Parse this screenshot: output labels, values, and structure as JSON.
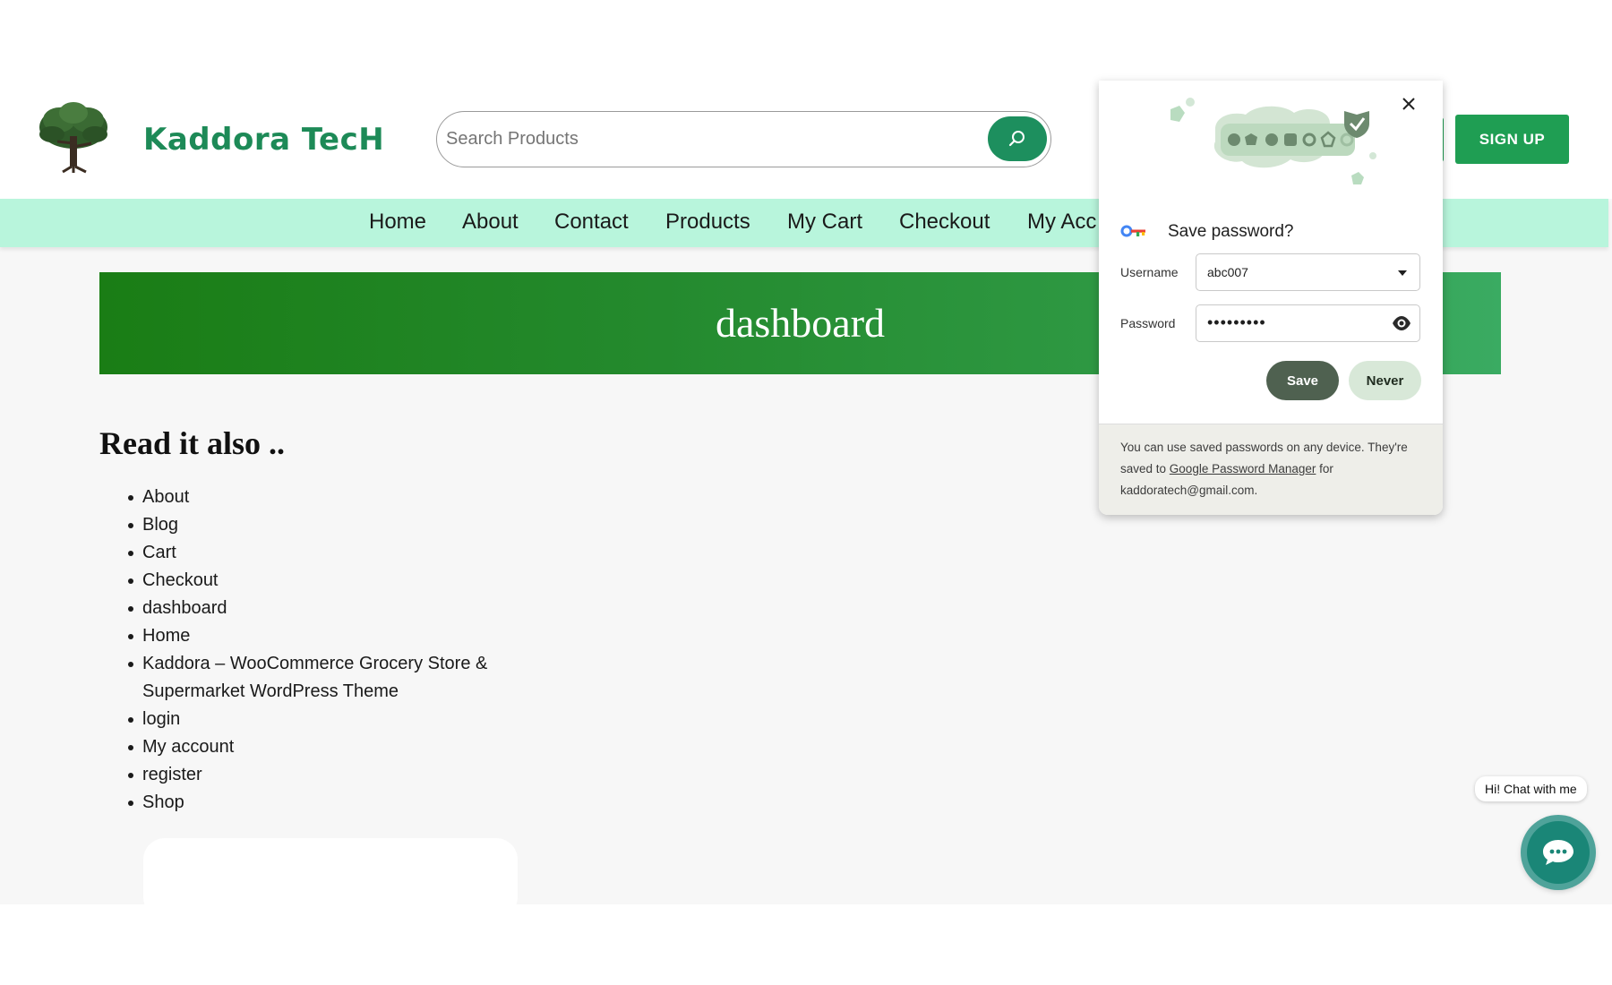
{
  "header": {
    "brand": "Kaddora TecH",
    "search_placeholder": "Search Products",
    "signup_label": "SIGN UP"
  },
  "nav": {
    "items": [
      "Home",
      "About",
      "Contact",
      "Products",
      "My Cart",
      "Checkout",
      "My Acc"
    ]
  },
  "banner": {
    "title": "dashboard"
  },
  "read_also": {
    "heading": "Read it also ..",
    "items": [
      "About",
      "Blog",
      "Cart",
      "Checkout",
      "dashboard",
      "Home",
      "Kaddora – WooCommerce Grocery Store & Supermarket WordPress Theme",
      "login",
      "My account",
      "register",
      "Shop"
    ]
  },
  "chat": {
    "bubble_text": "Hi! Chat with me"
  },
  "password_popup": {
    "title": "Save password?",
    "username_label": "Username",
    "username_value": "abc007",
    "password_label": "Password",
    "password_masked": "•••••••••",
    "save_label": "Save",
    "never_label": "Never",
    "footer_before": "You can use saved passwords on any device. They're saved to ",
    "footer_link": "Google Password Manager",
    "footer_after": " for kaddoratech@gmail.com."
  },
  "colors": {
    "brand_green": "#1d8a57",
    "nav_bg": "#b8f5dc",
    "banner_start": "#1a7d15",
    "banner_end": "#3aab62",
    "signup_bg": "#1f9e53",
    "chat_teal": "#1a8677",
    "save_btn": "#4f6150",
    "never_btn": "#d8e8d8"
  },
  "icons": {
    "logo": "tree-logo-icon",
    "search": "search-icon",
    "close": "close-icon",
    "key": "password-key-icon",
    "dropdown": "chevron-down-icon",
    "eye": "eye-icon",
    "chat": "chat-bubble-icon"
  }
}
